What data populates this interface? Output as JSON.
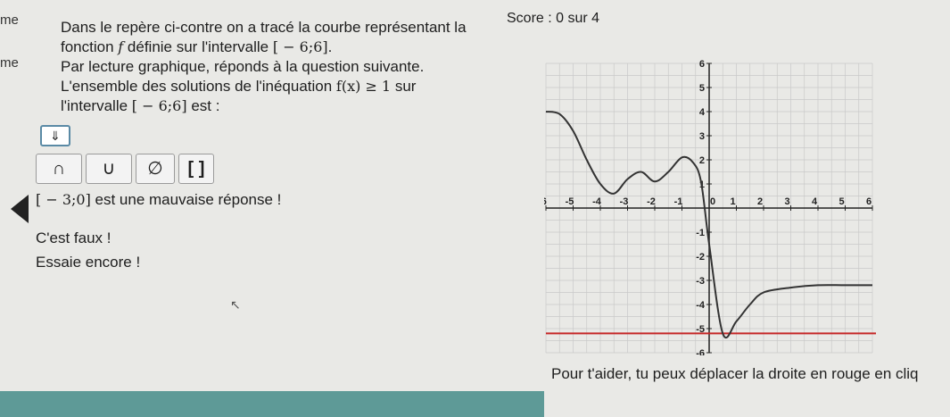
{
  "side_labels": [
    "me",
    "me"
  ],
  "score": "Score : 0 sur 4",
  "statement": {
    "line1": "Dans le repère ci-contre on a tracé la courbe représentant la",
    "line2_text": "fonction ",
    "line2_f": "f",
    "line2_text2": " définie sur l'intervalle ",
    "line2_interval": "[ − 6;6]",
    "line2_end": ".",
    "line3": "Par lecture graphique, réponds à la question suivante.",
    "line4_text": "L'ensemble des solutions de l'inéquation ",
    "line4_ineq": "f(x) ≥ 1",
    "line4_end": " sur",
    "line5_text": "l'intervalle ",
    "line5_interval": "[ − 6;6]",
    "line5_end": " est :"
  },
  "answer_input": {
    "value": "⇓"
  },
  "keyboard": {
    "inter": "∩",
    "union": "∪",
    "empty": "∅",
    "brackets": "[ ]"
  },
  "feedback": {
    "answer": "[ − 3;0]",
    "wrong": " est une mauvaise réponse !",
    "false": "C'est faux !",
    "retry": "Essaie encore !"
  },
  "help": "Pour t'aider, tu peux déplacer la droite en rouge en cliq",
  "chart_data": {
    "type": "line",
    "title": "",
    "xlabel": "",
    "ylabel": "",
    "xlim": [
      -6,
      6
    ],
    "ylim": [
      -6,
      6
    ],
    "x_ticks": [
      "-6",
      "-5",
      "-4",
      "-3",
      "-2",
      "-1",
      "0",
      "1",
      "2",
      "3",
      "4",
      "5",
      "6"
    ],
    "y_ticks": [
      "6",
      "5",
      "4",
      "3",
      "2",
      "1",
      "-1",
      "-2",
      "-3",
      "-4",
      "-5",
      "-6"
    ],
    "grid": true,
    "series": [
      {
        "x": [
          -6,
          -5.5,
          -5,
          -4.5,
          -4,
          -3.5,
          -3,
          -2.5,
          -2,
          -1.5,
          -1,
          -0.6,
          -0.3,
          0,
          0.5,
          1,
          1.5,
          2,
          3,
          4,
          5,
          6
        ],
        "y": [
          4,
          3.9,
          3.2,
          2.0,
          1.0,
          0.6,
          1.2,
          1.5,
          1.1,
          1.5,
          2.1,
          1.9,
          1.1,
          -1.5,
          -5.2,
          -4.7,
          -4.0,
          -3.5,
          -3.3,
          -3.2,
          -3.2,
          -3.2
        ],
        "color": "#333333"
      }
    ],
    "red_line_y": -5.2,
    "red_color": "#c62828"
  }
}
